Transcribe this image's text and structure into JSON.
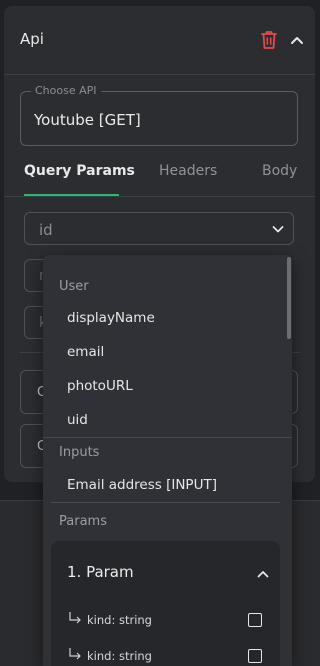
{
  "panel": {
    "title": "Api"
  },
  "api_select": {
    "legend": "Choose API",
    "value": "Youtube [GET]"
  },
  "tabs": [
    {
      "label": "Query Params",
      "active": true
    },
    {
      "label": "Headers",
      "active": false
    },
    {
      "label": "Body",
      "active": false
    }
  ],
  "param_select": {
    "placeholder": "id"
  },
  "ghost_inputs": [
    "n",
    "k"
  ],
  "ghost_rows": [
    "C",
    "C"
  ],
  "dropdown": {
    "groups": [
      {
        "label": "User",
        "options": [
          "displayName",
          "email",
          "photoURL",
          "uid"
        ]
      },
      {
        "label": "Inputs",
        "options": [
          "Email address [INPUT]"
        ]
      },
      {
        "label": "Params",
        "options": []
      }
    ],
    "param_card": {
      "title": "1. Param",
      "rows": [
        {
          "label": "kind: string",
          "checked": false
        },
        {
          "label": "kind: string",
          "checked": false
        }
      ]
    }
  },
  "colors": {
    "accent_green": "#2bb673",
    "delete_red": "#e24b4b"
  },
  "icons": [
    "trash-icon",
    "chevron-up-icon",
    "chevron-down-icon",
    "subdirectory-arrow-icon",
    "checkbox-icon"
  ]
}
